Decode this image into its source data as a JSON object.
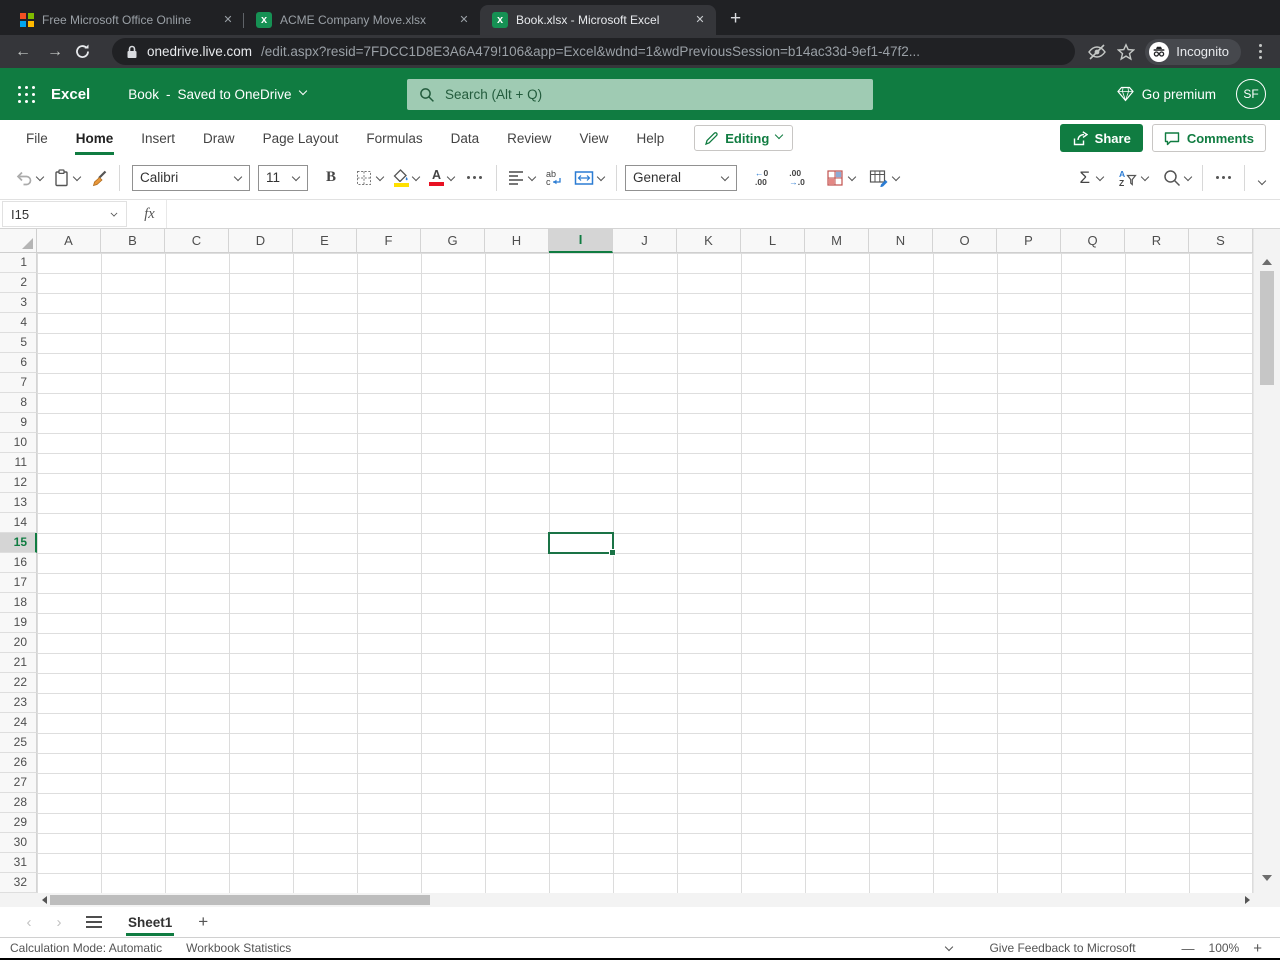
{
  "colors": {
    "excel_green": "#107c41",
    "chrome_dark": "#202124",
    "chrome_mid": "#35363a",
    "selection_green": "#1a7346",
    "fill_yellow": "#ffe000",
    "font_red": "#e81123"
  },
  "browser": {
    "tabs": [
      {
        "title": "Free Microsoft Office Online",
        "icon": "microsoft-logo",
        "active": false
      },
      {
        "title": "ACME Company Move.xlsx",
        "icon": "excel-file",
        "active": false
      },
      {
        "title": "Book.xlsx - Microsoft Excel",
        "icon": "excel-file",
        "active": true
      }
    ],
    "close_icon": "✕",
    "new_tab_icon": "+",
    "back_icon": "←",
    "forward_icon": "→",
    "address": {
      "domain": "onedrive.live.com",
      "path": "/edit.aspx?resid=7FDCC1D8E3A6A479!106&app=Excel&wdnd=1&wdPreviousSession=b14ac33d-9ef1-47f2...",
      "profile_label": "Incognito"
    }
  },
  "app_header": {
    "app_name": "Excel",
    "doc_title": "Book",
    "separator": "-",
    "save_status": "Saved to OneDrive",
    "search_placeholder": "Search (Alt + Q)",
    "premium_label": "Go premium",
    "avatar_initials": "SF"
  },
  "ribbon": {
    "tabs": [
      {
        "label": "File",
        "active": false
      },
      {
        "label": "Home",
        "active": true
      },
      {
        "label": "Insert",
        "active": false
      },
      {
        "label": "Draw",
        "active": false
      },
      {
        "label": "Page Layout",
        "active": false
      },
      {
        "label": "Formulas",
        "active": false
      },
      {
        "label": "Data",
        "active": false
      },
      {
        "label": "Review",
        "active": false
      },
      {
        "label": "View",
        "active": false
      },
      {
        "label": "Help",
        "active": false
      }
    ],
    "editing_label": "Editing",
    "share_label": "Share",
    "comments_label": "Comments"
  },
  "toolbar": {
    "font_name": "Calibri",
    "font_size": "11",
    "bold_label": "B",
    "number_format": "General",
    "decrease_decimal": {
      "top_arrow": "←",
      "top_num": "0",
      "bottom": ".00"
    },
    "increase_decimal": {
      "top": ".00",
      "bottom_arrow": "→",
      "bottom_num": ".0"
    },
    "sum_label": "Σ",
    "sort_a": "A",
    "sort_z": "Z",
    "wrap_ab": "ab",
    "wrap_c": "c"
  },
  "formula_bar": {
    "name_box_value": "I15",
    "fx_label": "fx",
    "formula_value": ""
  },
  "grid": {
    "column_headers": [
      "A",
      "B",
      "C",
      "D",
      "E",
      "F",
      "G",
      "H",
      "I",
      "J",
      "K",
      "L",
      "M",
      "N",
      "O",
      "P",
      "Q",
      "R",
      "S"
    ],
    "visible_rows": 32,
    "selected_cell": "I15",
    "selected_column": "I",
    "selected_row": 15
  },
  "sheet_bar": {
    "sheets": [
      {
        "name": "Sheet1",
        "active": true
      }
    ],
    "prev_icon": "‹",
    "next_icon": "›",
    "add_sheet_icon": "+"
  },
  "status_bar": {
    "calculation_mode": "Calculation Mode: Automatic",
    "workbook_statistics": "Workbook Statistics",
    "feedback": "Give Feedback to Microsoft",
    "zoom_out": "—",
    "zoom_level": "100%",
    "zoom_in": "+"
  }
}
